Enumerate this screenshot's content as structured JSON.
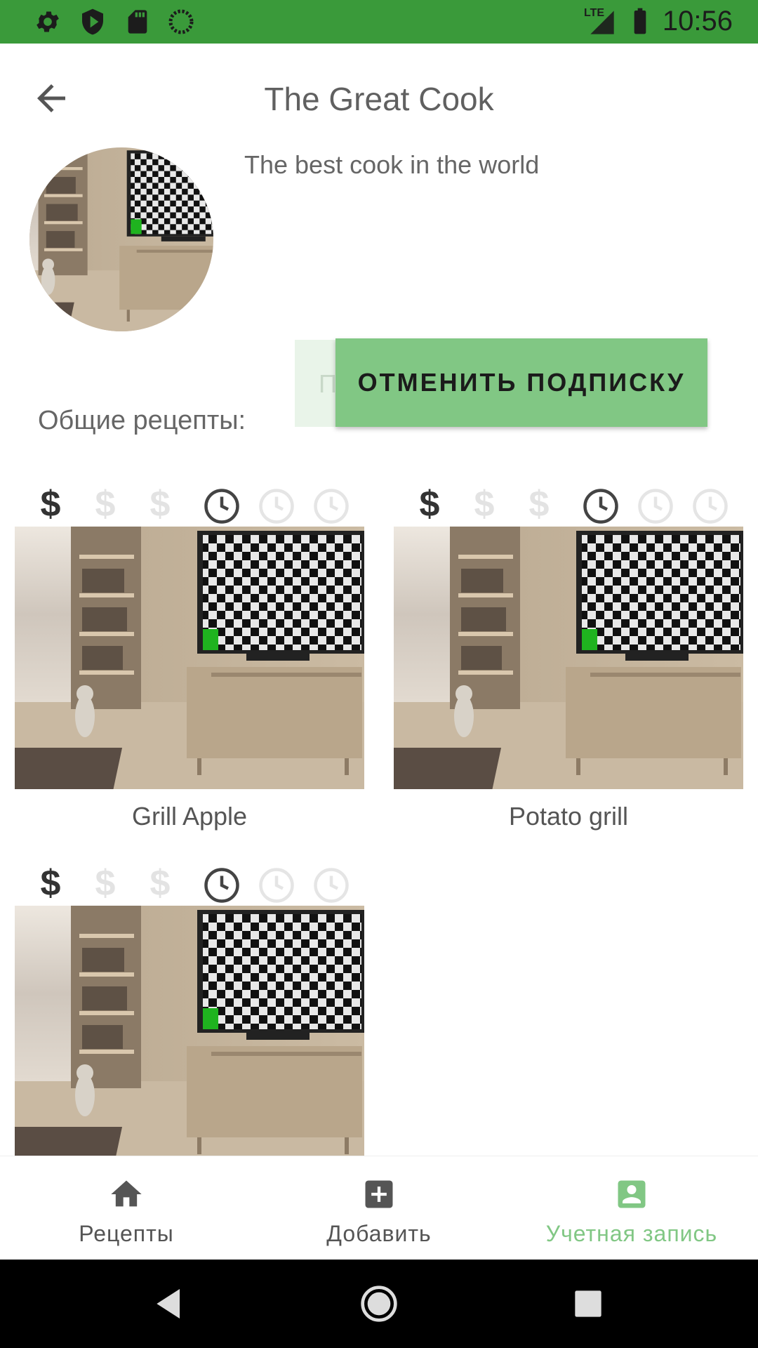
{
  "status_bar": {
    "time": "10:56",
    "network": "LTE",
    "bg_color": "#3a9a3a",
    "icons": [
      "settings-icon",
      "shield-icon",
      "sd-card-icon",
      "loading-icon",
      "lte-signal-icon",
      "battery-icon"
    ]
  },
  "app_bar": {
    "title": "The Great Cook",
    "back_icon": "arrow-back-icon"
  },
  "profile": {
    "description": "The best cook in the world",
    "subscribe_hidden_label": "П",
    "unsubscribe_label": "ОТМЕНИТЬ ПОДПИСКУ",
    "accent_color": "#81c784"
  },
  "recipes_section": {
    "title": "Общие рецепты:"
  },
  "recipes": [
    {
      "name": "Grill Apple",
      "price_level": 1,
      "price_max": 3,
      "time_level": 1,
      "time_max": 3
    },
    {
      "name": "Potato grill",
      "price_level": 1,
      "price_max": 3,
      "time_level": 1,
      "time_max": 3
    },
    {
      "name": "",
      "price_level": 1,
      "price_max": 3,
      "time_level": 1,
      "time_max": 3
    }
  ],
  "bottom_nav": {
    "items": [
      {
        "label": "Рецепты",
        "icon": "home-icon",
        "active": false
      },
      {
        "label": "Добавить",
        "icon": "add-box-icon",
        "active": false
      },
      {
        "label": "Учетная запись",
        "icon": "account-box-icon",
        "active": true
      }
    ],
    "active_color": "#81c784",
    "inactive_color": "#555555"
  },
  "system_nav": {
    "icons": [
      "back-triangle-icon",
      "home-circle-icon",
      "recents-square-icon"
    ]
  }
}
